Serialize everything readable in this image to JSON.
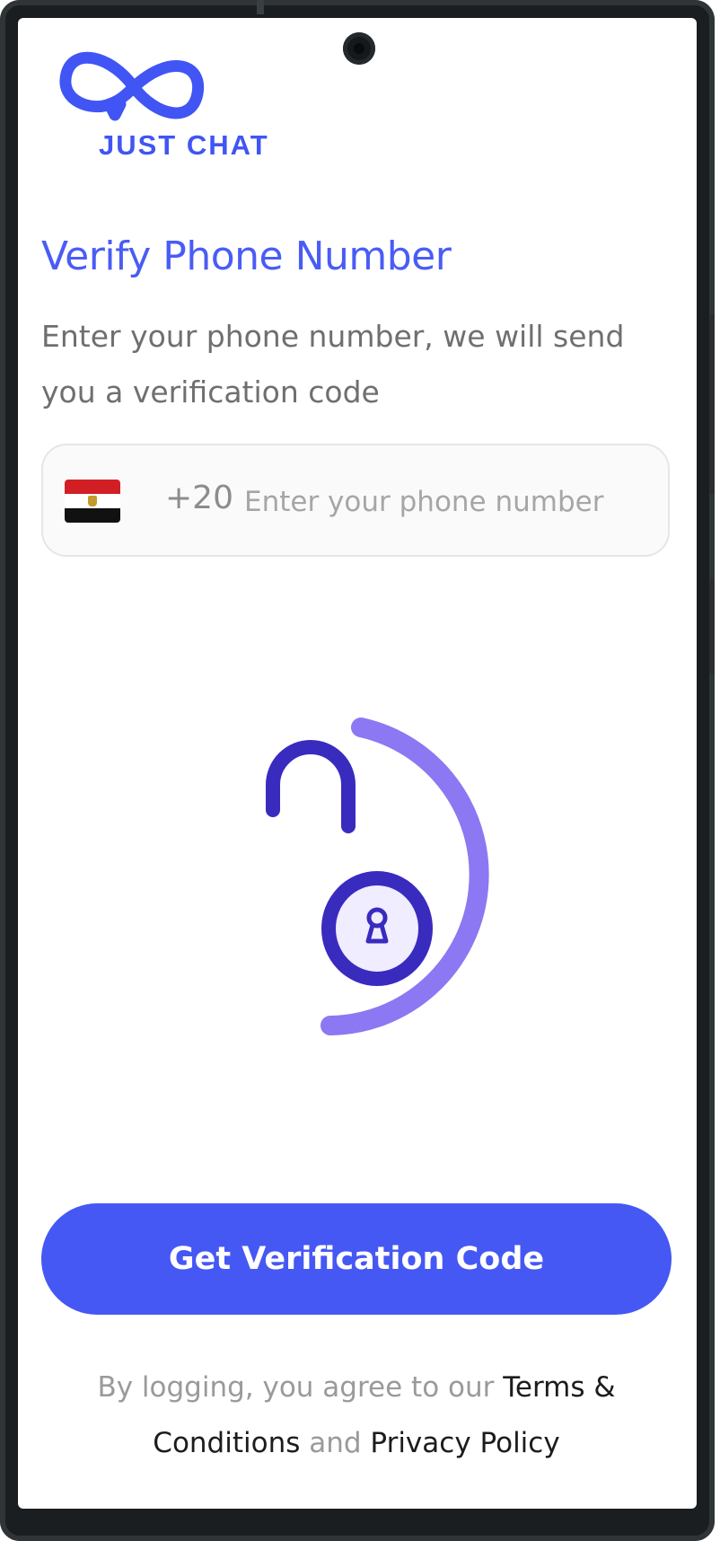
{
  "app": {
    "logo_text": "JUST CHAT",
    "brand_color": "#4055f4"
  },
  "verify": {
    "title": "Verify Phone Number",
    "subtitle": "Enter your phone number, we will send you a verification code"
  },
  "phone_input": {
    "country_flag": "egypt-flag-icon",
    "dial_code": "+20",
    "value": "",
    "placeholder": "Enter your phone number"
  },
  "illustration": {
    "icon": "unlocked-padlock-icon",
    "accent_color": "#8b78f2",
    "lock_color": "#3a2bbf"
  },
  "actions": {
    "primary_label": "Get Verification Code",
    "primary_color": "#4558f4"
  },
  "legal": {
    "prefix": "By logging, you agree to our ",
    "terms": "Terms & Conditions",
    "conjunction": " and ",
    "privacy": "Privacy Policy"
  }
}
